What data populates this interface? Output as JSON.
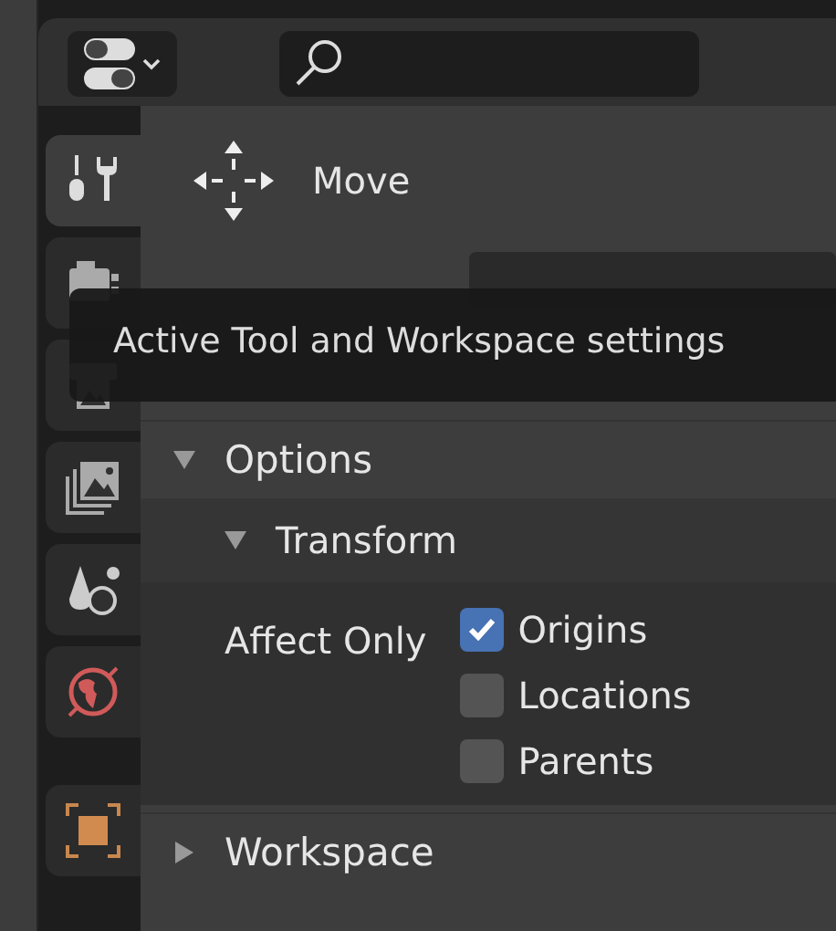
{
  "tabs": [
    {
      "kind": "tool",
      "selected": true
    },
    {
      "kind": "render",
      "selected": false
    },
    {
      "kind": "output",
      "selected": false
    },
    {
      "kind": "view_layer",
      "selected": false
    },
    {
      "kind": "scene",
      "selected": false
    },
    {
      "kind": "world",
      "selected": false
    },
    {
      "kind": "object",
      "selected": false
    }
  ],
  "tool": {
    "name": "Move"
  },
  "tooltip": {
    "text": "Active Tool and Workspace settings"
  },
  "panels": [
    {
      "title": "Options",
      "expanded": true,
      "subpanels": [
        {
          "title": "Transform",
          "expanded": true,
          "label": "Affect Only",
          "options": [
            {
              "label": "Origins",
              "checked": true
            },
            {
              "label": "Locations",
              "checked": false
            },
            {
              "label": "Parents",
              "checked": false
            }
          ]
        }
      ]
    },
    {
      "title": "Workspace",
      "expanded": false
    }
  ]
}
